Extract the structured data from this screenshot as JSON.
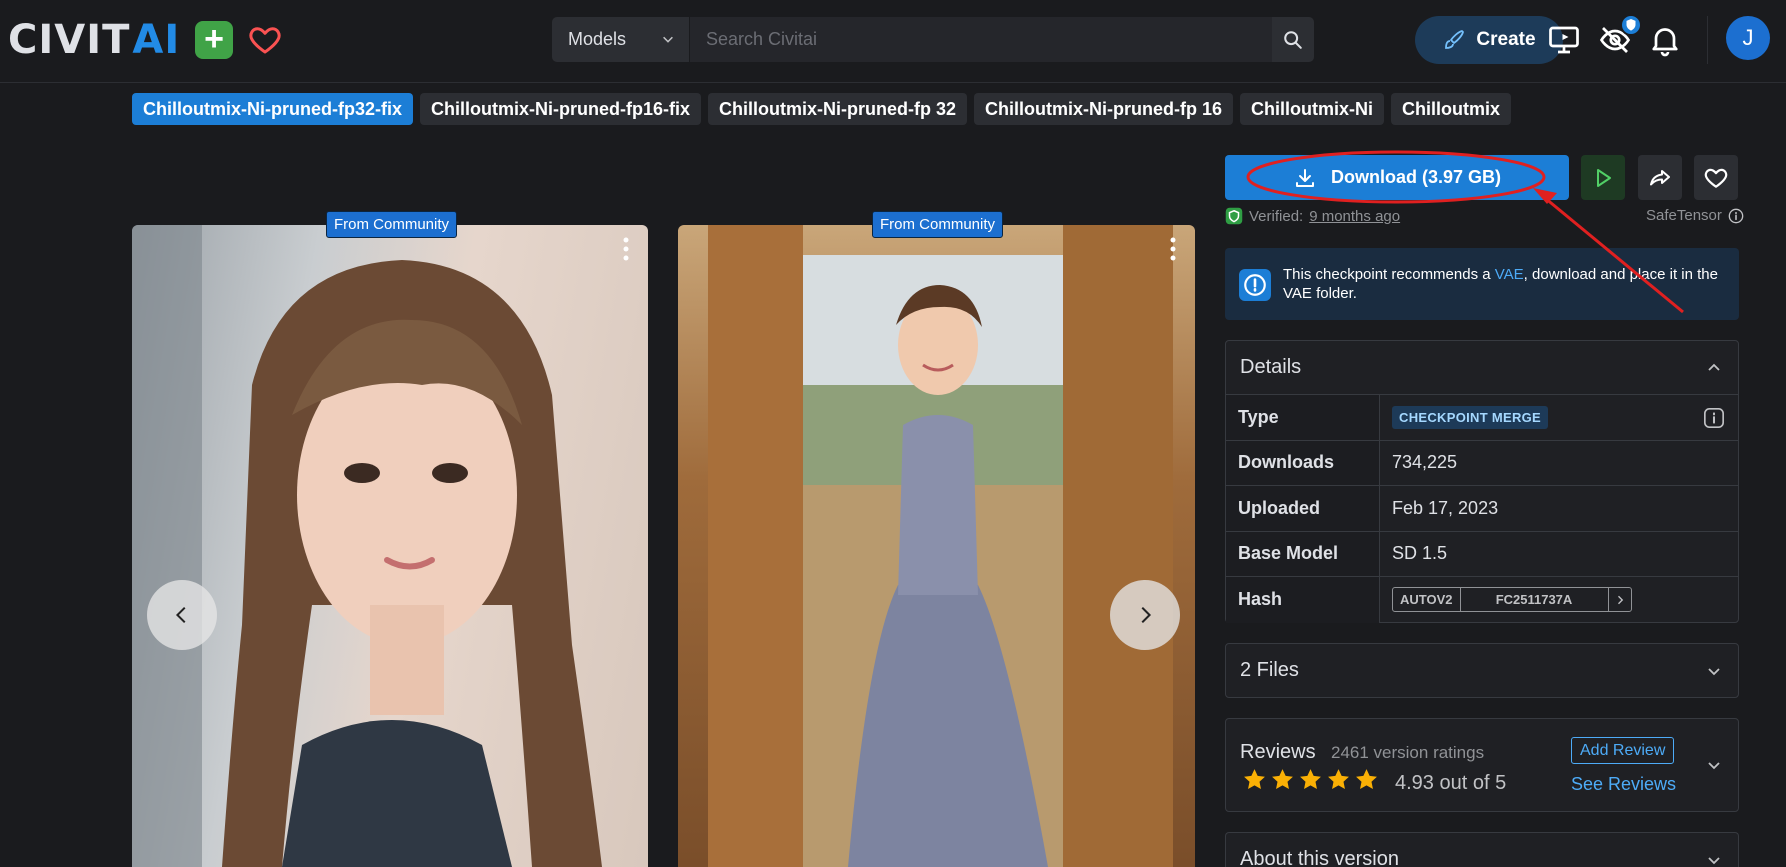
{
  "header": {
    "logo_civ": "CIVIT",
    "logo_ai": "AI",
    "plus_label": "+",
    "search_select": "Models",
    "search_placeholder": "Search Civitai",
    "search_shortcut": "/",
    "create_label": "Create",
    "avatar_initial": "J"
  },
  "versions": [
    {
      "label": "Chilloutmix-Ni-pruned-fp32-fix",
      "active": true
    },
    {
      "label": "Chilloutmix-Ni-pruned-fp16-fix",
      "active": false
    },
    {
      "label": "Chilloutmix-Ni-pruned-fp 32",
      "active": false
    },
    {
      "label": "Chilloutmix-Ni-pruned-fp 16",
      "active": false
    },
    {
      "label": "Chilloutmix-Ni",
      "active": false
    },
    {
      "label": "Chilloutmix",
      "active": false
    }
  ],
  "gallery": {
    "badge1": "From Community",
    "badge2": "From Community"
  },
  "download": {
    "label": "Download (3.97 GB)",
    "verified_prefix": "Verified:",
    "verified_time": "9 months ago",
    "format": "SafeTensor"
  },
  "alert": {
    "pre": "This checkpoint recommends a ",
    "link": "VAE",
    "post": ", download and place it in the VAE folder."
  },
  "details": {
    "title": "Details",
    "rows": [
      {
        "label": "Type",
        "value": "CHECKPOINT MERGE"
      },
      {
        "label": "Downloads",
        "value": "734,225"
      },
      {
        "label": "Uploaded",
        "value": "Feb 17, 2023"
      },
      {
        "label": "Base Model",
        "value": "SD 1.5"
      },
      {
        "label": "Hash",
        "hash_type": "AUTOV2",
        "hash_value": "FC2511737A"
      }
    ]
  },
  "files": {
    "label": "2 Files"
  },
  "reviews": {
    "title": "Reviews",
    "count": "2461 version ratings",
    "rating": 4.93,
    "score_text": "4.93 out of 5",
    "add_label": "Add Review",
    "see_label": "See Reviews"
  },
  "about": {
    "label": "About this version"
  },
  "colors": {
    "accent": "#1c7ed6",
    "annotation": "#e02020",
    "star": "#fab005",
    "background": "#1a1b1e"
  }
}
